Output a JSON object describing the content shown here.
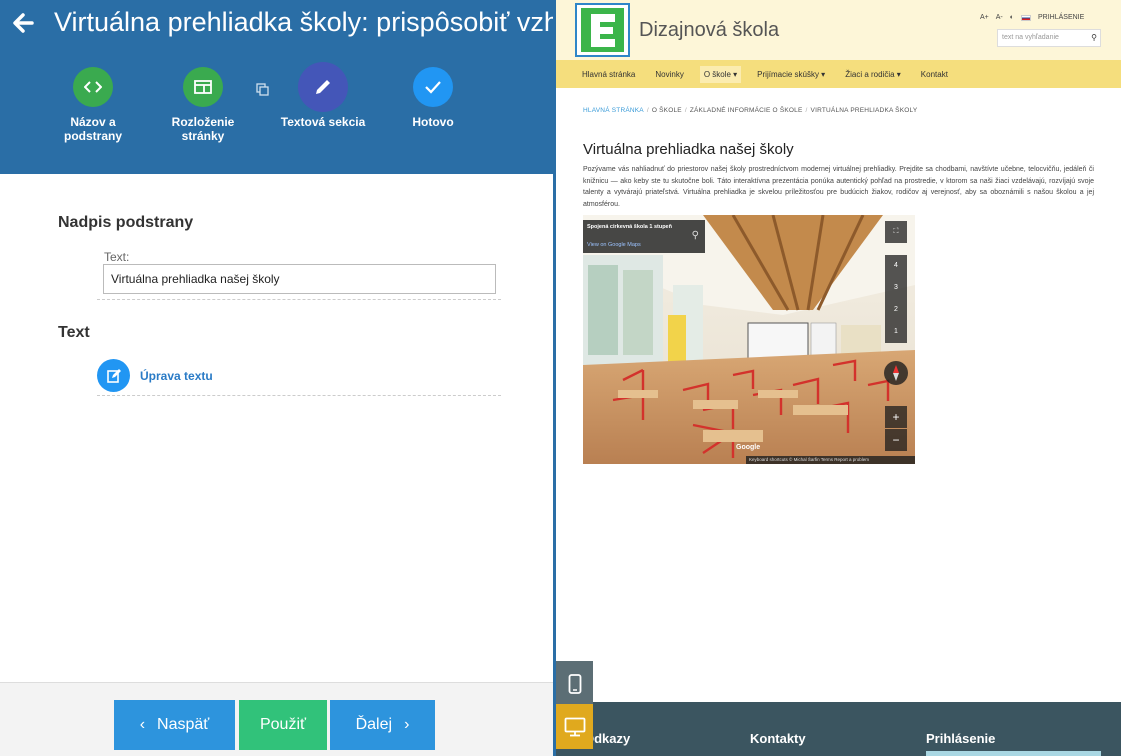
{
  "editor": {
    "title": "Virtuálna prehliadka školy: prispôsobiť vzhľad",
    "steps": [
      {
        "label_line1": "Názov a",
        "label_line2": "podstrany"
      },
      {
        "label_line1": "Rozloženie",
        "label_line2": "stránky"
      },
      {
        "label_line1": "Textová sekcia",
        "label_line2": ""
      },
      {
        "label_line1": "Hotovo",
        "label_line2": ""
      }
    ],
    "section_heading": "Nadpis podstrany",
    "text_label": "Text:",
    "text_value": "Virtuálna prehliadka našej školy",
    "section_text": "Text",
    "edit_text_label": "Úprava textu",
    "footer": {
      "back_label": "Naspäť",
      "apply_label": "Použiť",
      "next_label": "Ďalej"
    }
  },
  "preview": {
    "site_name": "Dizajnová škola",
    "tools": {
      "font_up": "A+",
      "font_down": "A-",
      "contrast": "◐",
      "login": "PRIHLÁSENIE"
    },
    "search_placeholder": "text na vyhľadanie",
    "nav": [
      "Hlavná stránka",
      "Novinky",
      "O škole ▾",
      "Prijímacie skúšky ▾",
      "Žiaci a rodičia ▾",
      "Kontakt"
    ],
    "breadcrumb": [
      "HLAVNÁ STRÁNKA",
      "O ŠKOLE",
      "ZÁKLADNÉ INFORMÁCIE O ŠKOLE",
      "VIRTUÁLNA PREHLIADKA ŠKOLY"
    ],
    "page_title": "Virtuálna prehliadka našej školy",
    "page_text": "Pozývame vás nahliadnuť do priestorov našej školy prostredníctvom modernej virtuálnej prehliadky. Prejdite sa chodbami, navštívte učebne, telocvičňu, jedáleň či knižnicu — ako keby ste tu skutočne boli. Táto interaktívna prezentácia ponúka autentický pohľad na prostredie, v ktorom sa naši žiaci vzdelávajú, rozvíjajú svoje talenty a vytvárajú priateľstvá. Virtuálna prehliadka je skvelou príležitosťou pre budúcich žiakov, rodičov aj verejnosť, aby sa oboznámili s našou školou a jej atmosférou.",
    "streetview": {
      "place": "Spojená cirkevná škola 1 stupeň",
      "view_link": "View on Google Maps",
      "floors": [
        "4",
        "3",
        "2",
        "1"
      ],
      "zoom_in": "+",
      "zoom_out": "−",
      "google": "Google",
      "footer_text": "Keyboard shortcuts   © Michal Šarfin   Terms   Report a problem"
    },
    "footer": {
      "col1": "Odkazy",
      "col2": "Kontakty",
      "col3": "Prihlásenie"
    }
  }
}
